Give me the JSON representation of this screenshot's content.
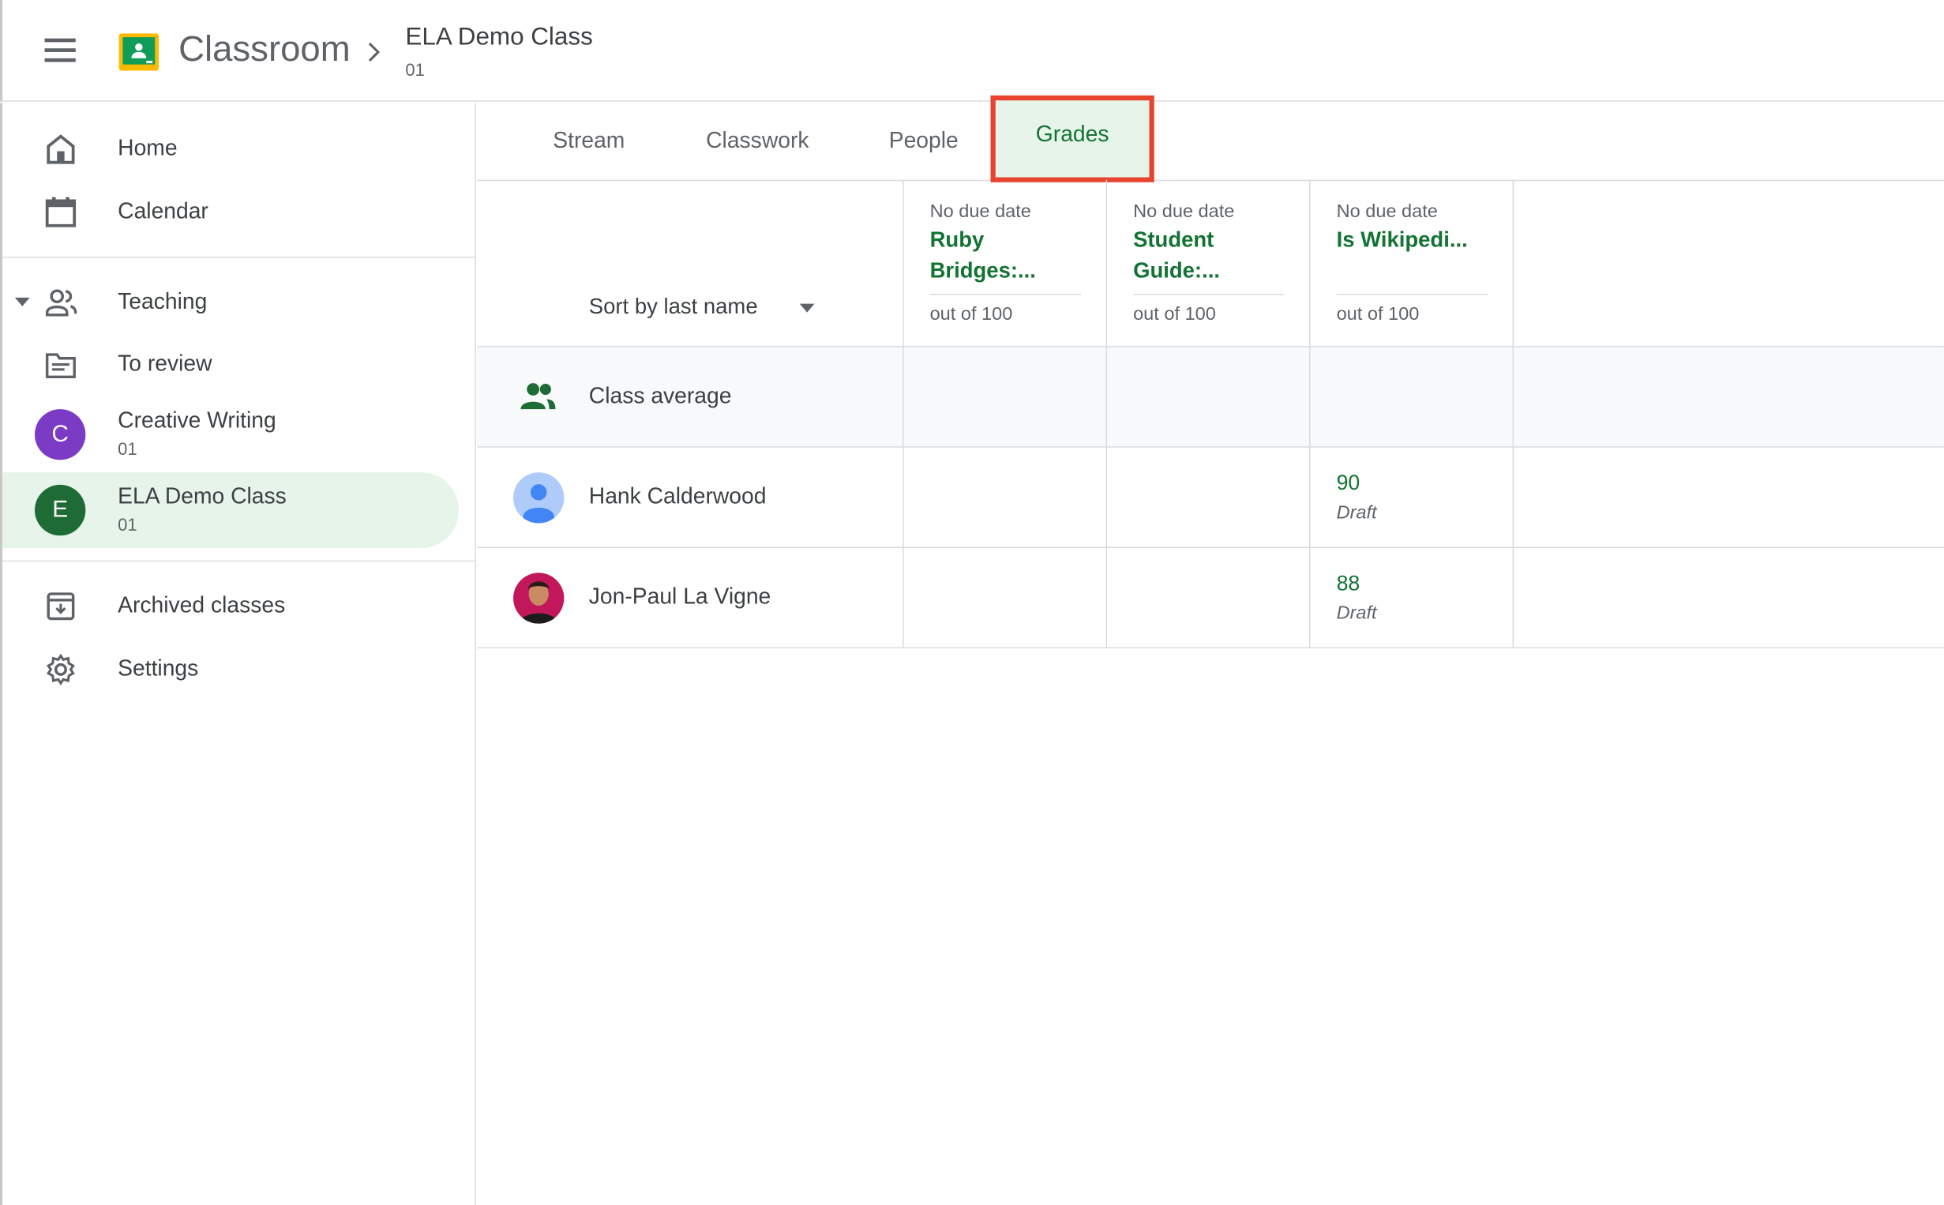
{
  "header": {
    "app_title": "Classroom",
    "class_title": "ELA Demo Class",
    "class_section": "01"
  },
  "sidebar": {
    "home": "Home",
    "calendar": "Calendar",
    "teaching": "Teaching",
    "to_review": "To review",
    "classes": [
      {
        "letter": "C",
        "name": "Creative Writing",
        "section": "01",
        "color": "#7b3bc4"
      },
      {
        "letter": "E",
        "name": "ELA Demo Class",
        "section": "01",
        "color": "#1e6b35"
      }
    ],
    "archived": "Archived classes",
    "settings": "Settings"
  },
  "tabs": [
    "Stream",
    "Classwork",
    "People",
    "Grades"
  ],
  "grades": {
    "sort_label": "Sort by last name",
    "assignments": [
      {
        "due": "No due date",
        "title": "Ruby Bridges:...",
        "out_of": "out of 100"
      },
      {
        "due": "No due date",
        "title": "Student Guide:...",
        "out_of": "out of 100"
      },
      {
        "due": "No due date",
        "title": "Is Wikipedi...",
        "out_of": "out of 100"
      }
    ],
    "class_average_label": "Class average",
    "students": [
      {
        "name": "Hank Calderwood",
        "grade_3": "90",
        "status_3": "Draft"
      },
      {
        "name": "Jon-Paul La Vigne",
        "grade_3": "88",
        "status_3": "Draft"
      }
    ]
  },
  "colors": {
    "accent": "#137333",
    "highlight_box": "#e8432e",
    "active_bg": "#e6f4ea"
  }
}
